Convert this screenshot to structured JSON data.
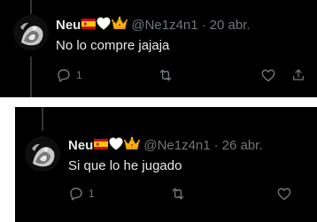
{
  "tweets": [
    {
      "display_name": "Neu",
      "badges": [
        "spain-flag",
        "white-heart",
        "crown"
      ],
      "handle": "@Ne1z4n1",
      "separator": "·",
      "date": "20 abr.",
      "text": "No lo compre jajaja",
      "actions": {
        "reply_count": "1",
        "reply_icon": "reply-icon",
        "retweet_icon": "retweet-icon",
        "like_icon": "heart-icon"
      }
    },
    {
      "display_name": "Neu",
      "badges": [
        "spain-flag",
        "white-heart",
        "crown"
      ],
      "handle": "@Ne1z4n1",
      "separator": "·",
      "date": "26 abr.",
      "text": "Si que lo he jugado",
      "actions": {
        "reply_count": "1",
        "reply_icon": "reply-icon",
        "retweet_icon": "retweet-icon",
        "like_icon": "heart-icon"
      }
    }
  ],
  "colors": {
    "background": "#000000",
    "text": "#e7e9ea",
    "secondary": "#71767b",
    "thread_line": "#333639",
    "page_gap": "#ffffff"
  }
}
